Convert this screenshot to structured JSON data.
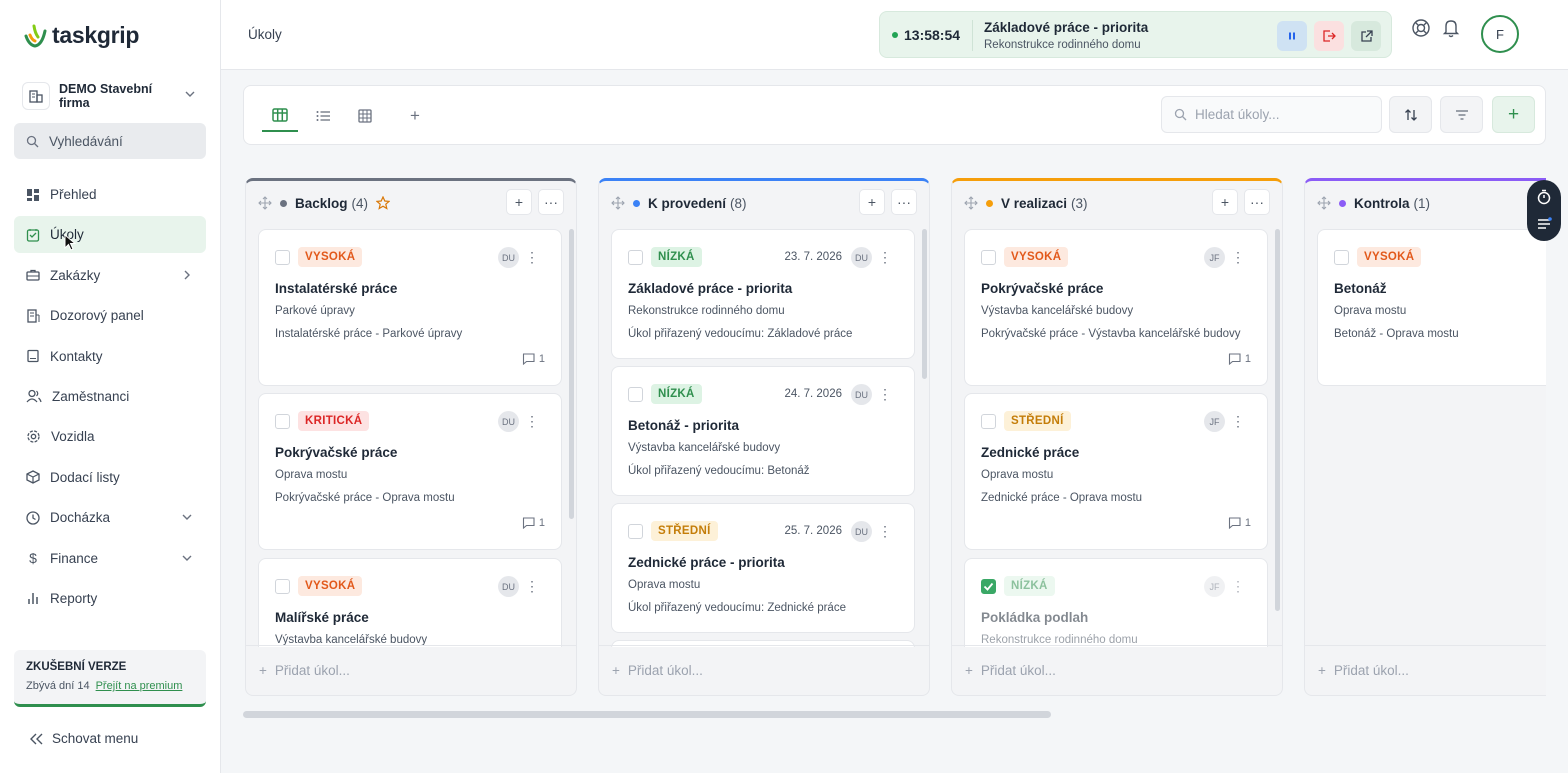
{
  "app": {
    "name": "taskgrip",
    "company": "DEMO Stavební firma",
    "search_placeholder": "Vyhledávání"
  },
  "nav": [
    {
      "label": "Přehled",
      "icon": "dashboard-icon"
    },
    {
      "label": "Úkoly",
      "icon": "checklist-icon",
      "active": true
    },
    {
      "label": "Zakázky",
      "icon": "briefcase-icon",
      "chevron": "right"
    },
    {
      "label": "Dozorový panel",
      "icon": "building-icon"
    },
    {
      "label": "Kontakty",
      "icon": "contacts-icon"
    },
    {
      "label": "Zaměstnanci",
      "icon": "users-icon"
    },
    {
      "label": "Vozidla",
      "icon": "gear-icon"
    },
    {
      "label": "Dodací listy",
      "icon": "package-icon"
    },
    {
      "label": "Docházka",
      "icon": "clock-icon",
      "chevron": "down"
    },
    {
      "label": "Finance",
      "icon": "dollar-icon",
      "chevron": "down"
    },
    {
      "label": "Reporty",
      "icon": "bar-chart-icon"
    }
  ],
  "trial": {
    "title": "ZKUŠEBNÍ VERZE",
    "days": "Zbývá dní 14",
    "link": "Přejít na premium"
  },
  "hide_menu": "Schovat menu",
  "header": {
    "breadcrumb": "Úkoly"
  },
  "timer": {
    "time": "13:58:54",
    "title": "Základové práce - priorita",
    "subtitle": "Rekonstrukce rodinného domu"
  },
  "user": {
    "initial": "F"
  },
  "toolbar": {
    "search_placeholder": "Hledat úkoly..."
  },
  "columns": [
    {
      "name": "Backlog",
      "count": "(4)",
      "color": "#6b7280",
      "starred": true,
      "add_label": "Přidat úkol...",
      "cards": [
        {
          "priority": "VYSOKÁ",
          "level": "vysoka",
          "date": "",
          "assignee": "DU",
          "title": "Instalatérské práce",
          "project": "Parkové úpravy",
          "desc": "Instalatérské práce - Parkové úpravy",
          "comments": "1"
        },
        {
          "priority": "KRITICKÁ",
          "level": "kriticka",
          "date": "",
          "assignee": "DU",
          "title": "Pokrývačské práce",
          "project": "Oprava mostu",
          "desc": "Pokrývačské práce - Oprava mostu",
          "comments": "1"
        },
        {
          "priority": "VYSOKÁ",
          "level": "vysoka",
          "date": "",
          "assignee": "DU",
          "title": "Malířské práce",
          "project": "Výstavba kancelářské budovy",
          "desc": "",
          "comments": ""
        }
      ]
    },
    {
      "name": "K provedení",
      "count": "(8)",
      "color": "#3b82f6",
      "starred": false,
      "add_label": "Přidat úkol...",
      "cards": [
        {
          "priority": "NÍZKÁ",
          "level": "nizka",
          "date": "23. 7. 2026",
          "assignee": "DU",
          "title": "Základové práce - priorita",
          "project": "Rekonstrukce rodinného domu",
          "desc": "Úkol přiřazený vedoucímu: Základové práce",
          "comments": ""
        },
        {
          "priority": "NÍZKÁ",
          "level": "nizka",
          "date": "24. 7. 2026",
          "assignee": "DU",
          "title": "Betonáž - priorita",
          "project": "Výstavba kancelářské budovy",
          "desc": "Úkol přiřazený vedoucímu: Betonáž",
          "comments": ""
        },
        {
          "priority": "STŘEDNÍ",
          "level": "stredni",
          "date": "25. 7. 2026",
          "assignee": "DU",
          "title": "Zednické práce - priorita",
          "project": "Oprava mostu",
          "desc": "Úkol přiřazený vedoucímu: Zednické práce",
          "comments": ""
        }
      ]
    },
    {
      "name": "V realizaci",
      "count": "(3)",
      "color": "#f59e0b",
      "starred": false,
      "add_label": "Přidat úkol...",
      "cards": [
        {
          "priority": "VYSOKÁ",
          "level": "vysoka",
          "date": "",
          "assignee": "JF",
          "title": "Pokrývačské práce",
          "project": "Výstavba kancelářské budovy",
          "desc": "Pokrývačské práce - Výstavba kancelářské budovy",
          "comments": "1"
        },
        {
          "priority": "STŘEDNÍ",
          "level": "stredni",
          "date": "",
          "assignee": "JF",
          "title": "Zednické práce",
          "project": "Oprava mostu",
          "desc": "Zednické práce - Oprava mostu",
          "comments": "1"
        },
        {
          "priority": "NÍZKÁ",
          "level": "nizka",
          "date": "",
          "assignee": "JF",
          "title": "Pokládka podlah",
          "project": "Rekonstrukce rodinného domu",
          "desc": "",
          "comments": "",
          "done": true
        }
      ]
    },
    {
      "name": "Kontrola",
      "count": "(1)",
      "color": "#8b5cf6",
      "starred": false,
      "add_label": "Přidat úkol...",
      "cards": [
        {
          "priority": "VYSOKÁ",
          "level": "vysoka",
          "date": "",
          "assignee": "",
          "title": "Betonáž",
          "project": "Oprava mostu",
          "desc": "Betonáž - Oprava mostu",
          "comments": ""
        }
      ]
    }
  ]
}
